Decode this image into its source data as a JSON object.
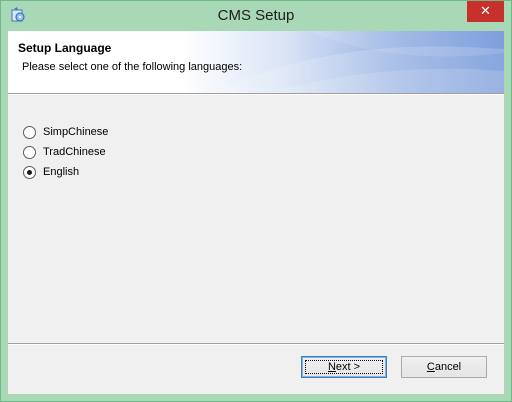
{
  "window": {
    "title": "CMS Setup",
    "close_glyph": "✕",
    "icon": "setup-icon"
  },
  "banner": {
    "title": "Setup Language",
    "subtitle": "Please select one of the following languages:"
  },
  "languages": {
    "selected": "English",
    "options": [
      {
        "label": "SimpChinese",
        "checked": false
      },
      {
        "label": "TradChinese",
        "checked": false
      },
      {
        "label": "English",
        "checked": true
      }
    ]
  },
  "buttons": {
    "next": {
      "mnemonic": "N",
      "rest": "ext >"
    },
    "cancel": {
      "mnemonic": "C",
      "rest": "ancel"
    }
  },
  "colors": {
    "titlebar": "#a8d8b5",
    "close": "#c7302b",
    "banner_accent": "#6d92d8"
  }
}
